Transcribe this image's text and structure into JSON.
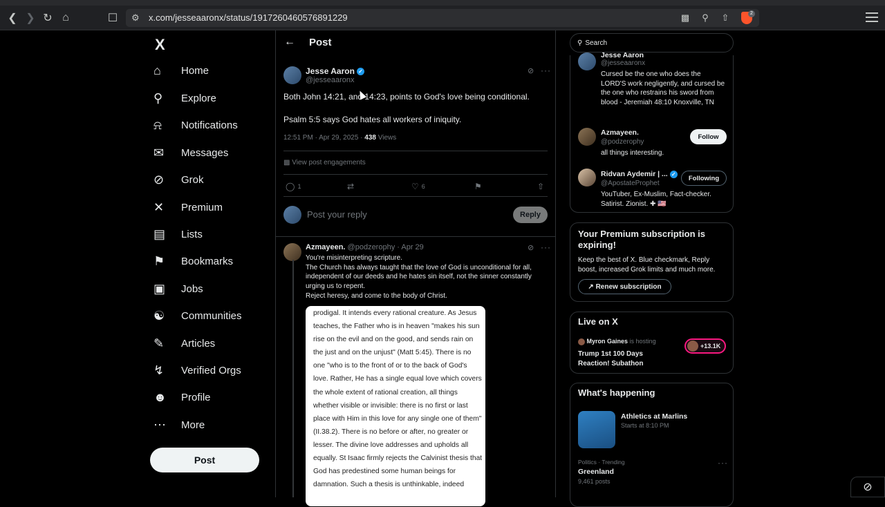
{
  "browser": {
    "url": "x.com/jesseaaronx/status/1917260460576891229",
    "extension_badge": "2"
  },
  "nav": {
    "logo": "X",
    "items": [
      {
        "label": "Home",
        "icon": "home-icon"
      },
      {
        "label": "Explore",
        "icon": "search-icon"
      },
      {
        "label": "Notifications",
        "icon": "bell-icon"
      },
      {
        "label": "Messages",
        "icon": "envelope-icon"
      },
      {
        "label": "Grok",
        "icon": "grok-icon"
      },
      {
        "label": "Premium",
        "icon": "x-icon"
      },
      {
        "label": "Lists",
        "icon": "list-icon"
      },
      {
        "label": "Bookmarks",
        "icon": "bookmark-icon"
      },
      {
        "label": "Jobs",
        "icon": "briefcase-icon"
      },
      {
        "label": "Communities",
        "icon": "people-icon"
      },
      {
        "label": "Articles",
        "icon": "article-icon"
      },
      {
        "label": "Verified Orgs",
        "icon": "lightning-icon"
      },
      {
        "label": "Profile",
        "icon": "person-icon"
      },
      {
        "label": "More",
        "icon": "more-circle-icon"
      }
    ],
    "post_button": "Post"
  },
  "header": {
    "title": "Post"
  },
  "post": {
    "author": "Jesse Aaron",
    "handle": "@jesseaaronx",
    "text1": "Both John 14:21, and 14:23, points to God's love being conditional.",
    "text2": "Psalm 5:5 says God hates all workers of iniquity.",
    "time": "12:51 PM · Apr 29, 2025 ·",
    "views_count": "438",
    "views_label": "Views",
    "engagements": "View post engagements",
    "replies": "1",
    "likes": "6"
  },
  "reply_box": {
    "placeholder": "Post your reply",
    "button": "Reply"
  },
  "reply": {
    "author": "Azmayeen.",
    "meta": "@podzerophy · Apr 29",
    "lines": [
      "You're misinterpreting scripture.",
      "The Church has always taught that the love of God is unconditional for all, independent of our deeds and he hates sin itself, not the sinner constantly urging us to repent.",
      "Reject heresy, and come to the body of Christ."
    ],
    "image_text": "prodigal. It intends every rational creature. As Jesus teaches, the Father who is in heaven \"makes his sun rise on the evil and on the good, and sends rain on the just and on the unjust\" (Matt 5:45). There is no one \"who is to the front of or to the back of God's love. Rather, He has a single equal love which covers the whole extent of rational creation, all things whether visible or invisible: there is no first or last place with Him in this love for any single one of them\" (II.38.2). There is no before or after, no greater or lesser. The divine love addresses and upholds all equally. St Isaac firmly rejects the Calvinist thesis that God has predestined some human beings for damnation. Such a thesis is unthinkable, indeed"
  },
  "right": {
    "search_placeholder": "Search",
    "people": [
      {
        "name": "Jesse Aaron",
        "handle": "@jesseaaronx",
        "bio": "Cursed be the one who does the LORD'S work negligently, and cursed be the one who restrains his sword from blood - Jeremiah 48:10 Knoxville, TN"
      },
      {
        "name": "Azmayeen.",
        "handle": "@podzerophy",
        "bio": "all things interesting.",
        "button": "Follow"
      },
      {
        "name": "Ridvan Aydemir | ...",
        "handle": "@ApostateProphet",
        "bio": "YouTuber, Ex-Muslim, Fact-checker. Satirist. Zionist. ✚ 🇺🇸",
        "button": "Following"
      }
    ],
    "premium": {
      "title": "Your Premium subscription is expiring!",
      "text": "Keep the best of X. Blue checkmark, Reply boost, increased Grok limits and much more.",
      "button": "Renew subscription"
    },
    "live": {
      "title": "Live on X",
      "host": "Myron Gaines",
      "host_suffix": "is hosting",
      "event": "Trump 1st 100 Days Reaction! Subathon",
      "count": "+13.1K"
    },
    "happening": {
      "title": "What's happening",
      "event_title": "Athletics at Marlins",
      "event_time": "Starts at 8:10 PM",
      "trend_cat": "Politics · Trending",
      "trend_name": "Greenland",
      "trend_posts": "9,461 posts"
    }
  }
}
